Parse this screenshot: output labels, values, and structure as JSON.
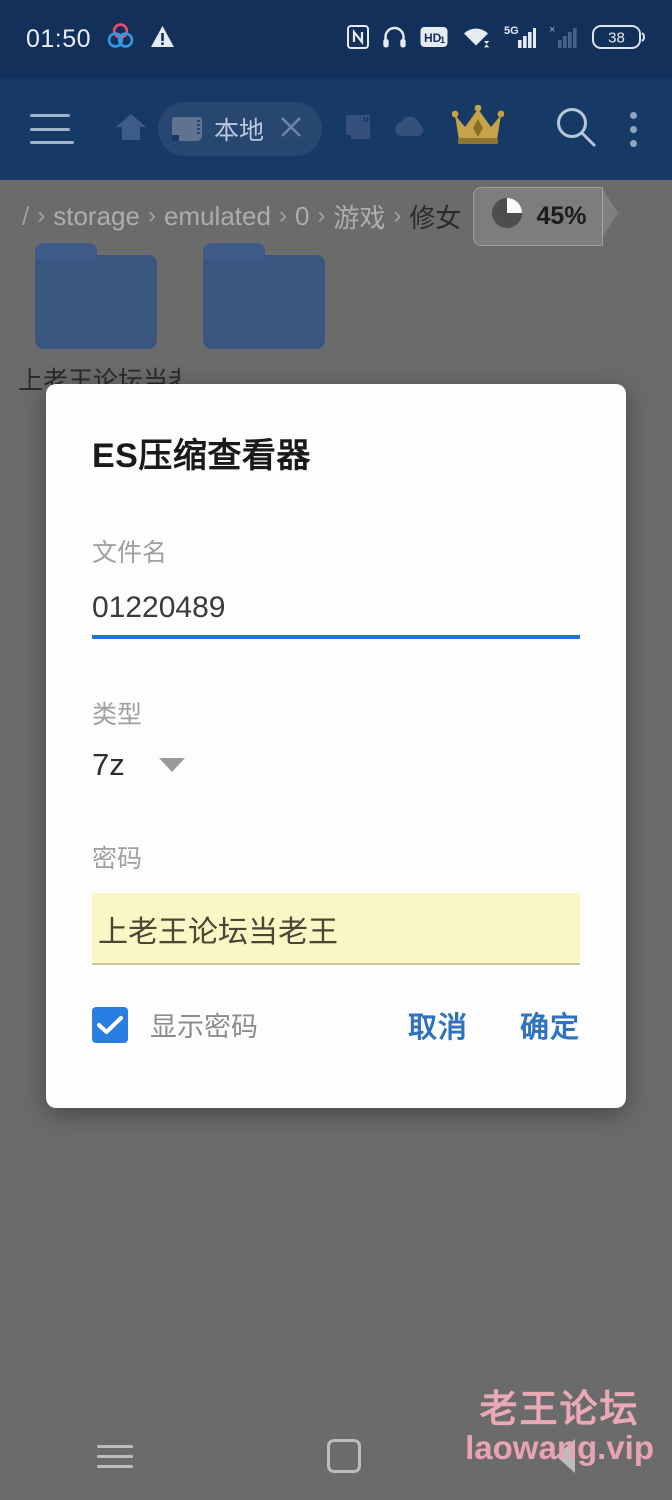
{
  "statusbar": {
    "time": "01:50",
    "left_icons": [
      "tri-circle-app-icon",
      "warning-triangle-icon"
    ],
    "right_icons": [
      "nfc-icon",
      "headphones-icon",
      "hd-voice-icon",
      "wifi-icon",
      "signal-5g-icon",
      "signal-no-sim-icon"
    ],
    "battery_level": "38"
  },
  "toolbar": {
    "menu_icon": "hamburger-menu-icon",
    "home_icon": "home-icon",
    "tab_label": "本地",
    "tab_icon": "sdcard-icon",
    "tab_close_icon": "close-icon",
    "sdcard2_icon": "sdcard-icon",
    "cloud_icon": "cloud-icon",
    "crown_icon": "crown-icon",
    "search_icon": "search-icon",
    "overflow_icon": "kebab-menu-icon"
  },
  "breadcrumb": {
    "segments": [
      "/",
      "storage",
      "emulated",
      "0",
      "游戏",
      "修女"
    ],
    "separator": "›",
    "storage_badge": {
      "icon": "pie-chart-icon",
      "percent": "45%"
    }
  },
  "files": [
    {
      "name": "上老王论坛当老王"
    },
    {
      "name": ""
    }
  ],
  "dialog": {
    "title": "ES压缩查看器",
    "filename_label": "文件名",
    "filename_value": "01220489",
    "type_label": "类型",
    "type_value": "7z",
    "type_caret_icon": "chevron-down-icon",
    "password_label": "密码",
    "password_value": "上老王论坛当老王",
    "show_password_label": "显示密码",
    "show_password_checked": true,
    "cancel_label": "取消",
    "confirm_label": "确定",
    "accent_color": "#1e76d2",
    "autofill_color": "#fbf6c6"
  },
  "navbar": {
    "recent_icon": "recent-apps-icon",
    "home_icon": "home-square-icon",
    "back_icon": "back-triangle-icon"
  },
  "watermark": {
    "line1": "老王论坛",
    "line2": "laowang.vip"
  }
}
